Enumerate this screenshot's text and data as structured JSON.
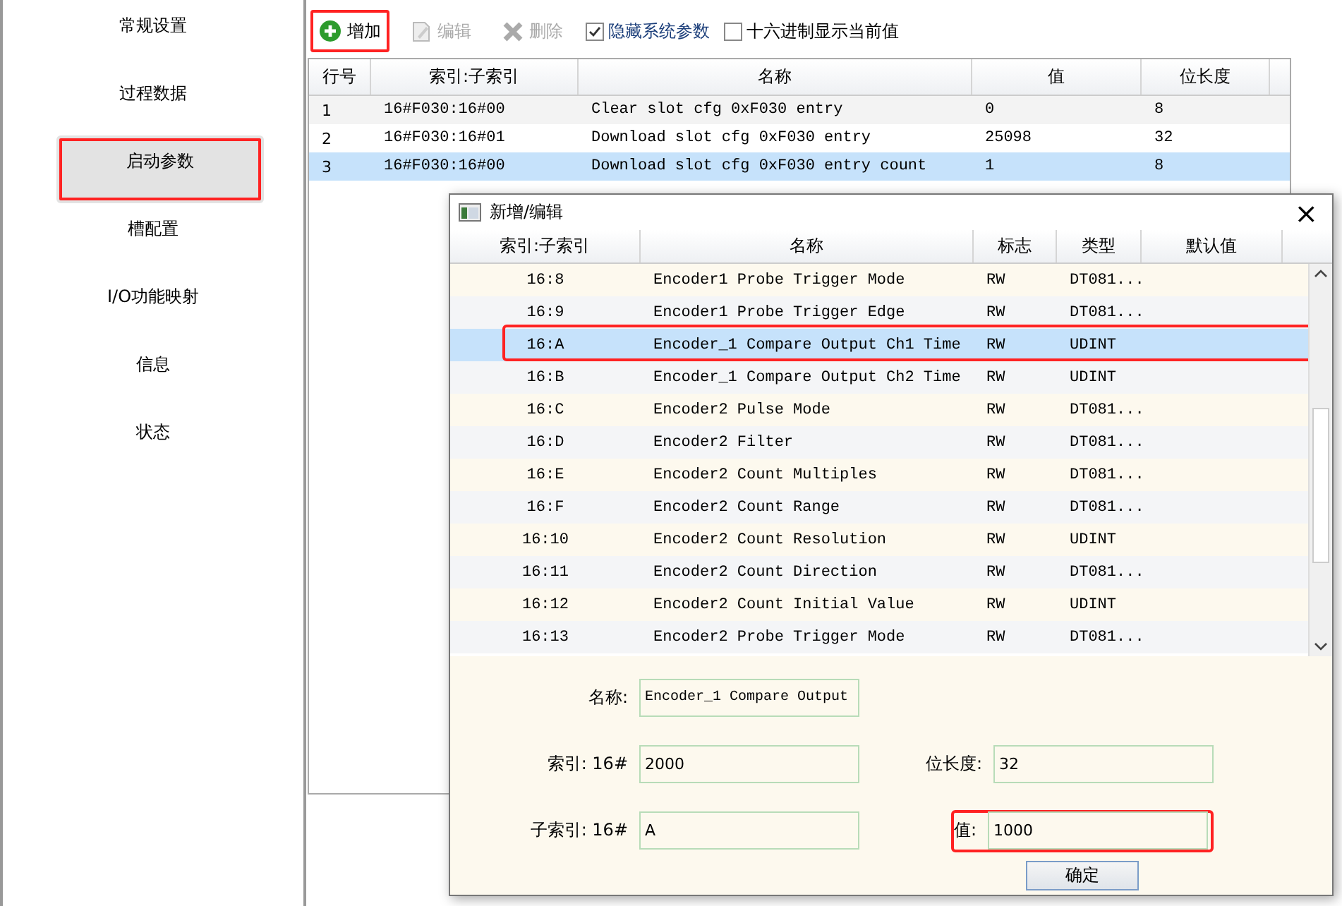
{
  "sidebar": {
    "items": [
      {
        "label": "常规设置",
        "selected": false,
        "highlighted": false
      },
      {
        "label": "过程数据",
        "selected": false,
        "highlighted": false
      },
      {
        "label": "启动参数",
        "selected": true,
        "highlighted": true
      },
      {
        "label": "槽配置",
        "selected": false,
        "highlighted": false
      },
      {
        "label": "I/O功能映射",
        "selected": false,
        "highlighted": false
      },
      {
        "label": "信息",
        "selected": false,
        "highlighted": false
      },
      {
        "label": "状态",
        "selected": false,
        "highlighted": false
      }
    ]
  },
  "toolbar": {
    "buttons": [
      {
        "kind": "add",
        "label": "增加",
        "disabled": false,
        "highlighted": true
      },
      {
        "kind": "edit",
        "label": "编辑",
        "disabled": true,
        "highlighted": false
      },
      {
        "kind": "delete",
        "label": "删除",
        "disabled": true,
        "highlighted": false
      }
    ],
    "checkboxes": [
      {
        "label": "隐藏系统参数",
        "checked": true
      },
      {
        "label": "十六进制显示当前值",
        "checked": false
      }
    ]
  },
  "table": {
    "columns": [
      "行号",
      "索引:子索引",
      "名称",
      "值",
      "位长度"
    ],
    "rows": [
      {
        "cells": [
          "1",
          "16#F030:16#00",
          "Clear slot cfg 0xF030 entry",
          "0",
          "8"
        ],
        "selected": false
      },
      {
        "cells": [
          "2",
          "16#F030:16#01",
          "Download slot cfg 0xF030 entry",
          "25098",
          "32"
        ],
        "selected": false
      },
      {
        "cells": [
          "3",
          "16#F030:16#00",
          "Download slot cfg 0xF030 entry count",
          "1",
          "8"
        ],
        "selected": true
      }
    ]
  },
  "dialog": {
    "title": "新增/编辑",
    "close": "×",
    "columns": [
      "索引:子索引",
      "名称",
      "标志",
      "类型",
      "默认值"
    ],
    "rows": [
      {
        "cells": [
          "16:8",
          "Encoder1 Probe Trigger Mode",
          "RW",
          "DT081..."
        ],
        "selected": false,
        "highlighted": false
      },
      {
        "cells": [
          "16:9",
          "Encoder1 Probe Trigger Edge",
          "RW",
          "DT081..."
        ],
        "selected": false,
        "highlighted": false
      },
      {
        "cells": [
          "16:A",
          "Encoder_1 Compare Output Ch1 Time",
          "RW",
          "UDINT"
        ],
        "selected": true,
        "highlighted": true
      },
      {
        "cells": [
          "16:B",
          "Encoder_1 Compare Output Ch2 Time",
          "RW",
          "UDINT"
        ],
        "selected": false,
        "highlighted": false
      },
      {
        "cells": [
          "16:C",
          "Encoder2 Pulse Mode",
          "RW",
          "DT081..."
        ],
        "selected": false,
        "highlighted": false
      },
      {
        "cells": [
          "16:D",
          "Encoder2 Filter",
          "RW",
          "DT081..."
        ],
        "selected": false,
        "highlighted": false
      },
      {
        "cells": [
          "16:E",
          "Encoder2 Count Multiples",
          "RW",
          "DT081..."
        ],
        "selected": false,
        "highlighted": false
      },
      {
        "cells": [
          "16:F",
          "Encoder2 Count Range",
          "RW",
          "DT081..."
        ],
        "selected": false,
        "highlighted": false
      },
      {
        "cells": [
          "16:10",
          "Encoder2 Count Resolution",
          "RW",
          "UDINT"
        ],
        "selected": false,
        "highlighted": false
      },
      {
        "cells": [
          "16:11",
          "Encoder2 Count Direction",
          "RW",
          "DT081..."
        ],
        "selected": false,
        "highlighted": false
      },
      {
        "cells": [
          "16:12",
          "Encoder2 Count Initial Value",
          "RW",
          "UDINT"
        ],
        "selected": false,
        "highlighted": false
      },
      {
        "cells": [
          "16:13",
          "Encoder2 Probe Trigger Mode",
          "RW",
          "DT081..."
        ],
        "selected": false,
        "highlighted": false
      }
    ],
    "form": {
      "name": {
        "label": "名称:",
        "value": "Encoder_1 Compare Output"
      },
      "index": {
        "label": "索引: 16#",
        "value": "2000"
      },
      "subindex": {
        "label": "子索引: 16#",
        "value": "A"
      },
      "bit_length": {
        "label": "位长度:",
        "value": "32",
        "highlighted": false
      },
      "value": {
        "label": "值:",
        "value": "1000",
        "highlighted": true
      }
    },
    "ok_button": "确定"
  }
}
